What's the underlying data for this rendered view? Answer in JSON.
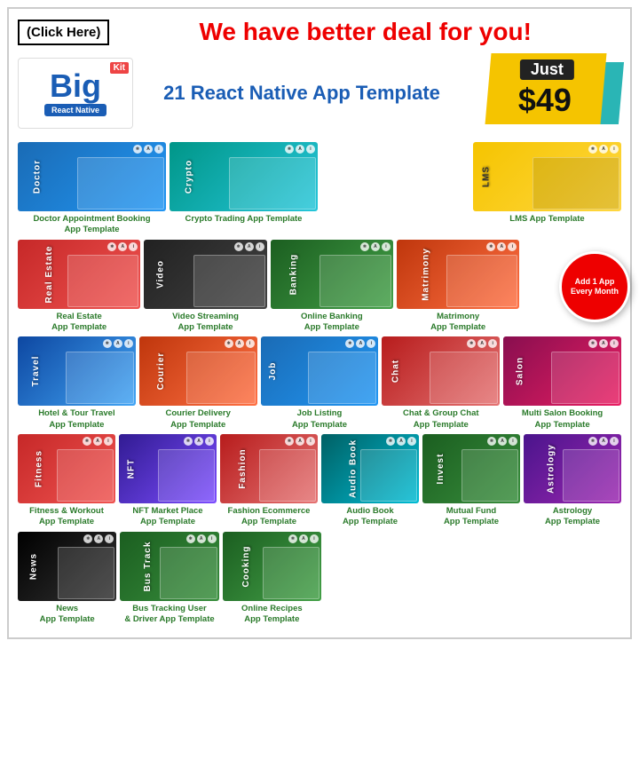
{
  "header": {
    "click_here": "(Click Here)",
    "deal_text": "We have better deal for you!"
  },
  "promo": {
    "logo_big": "Big",
    "logo_kit": "Kit",
    "logo_rn": "React Native",
    "template_count": "21 React Native App Template",
    "price_just": "Just",
    "price_amount": "$49"
  },
  "add_badge": "Add 1 App Every Month",
  "apps": [
    {
      "id": "doctor",
      "label": "Doctor",
      "title1": "Doctor Appointment Booking",
      "title2": "App Template",
      "bg": "bg-blue"
    },
    {
      "id": "crypto",
      "label": "Crypto",
      "title1": "Crypto Trading App Template",
      "title2": "",
      "bg": "bg-teal"
    },
    {
      "id": "lms",
      "label": "LMS",
      "title1": "LMS App Template",
      "title2": "",
      "bg": "bg-yellow"
    },
    {
      "id": "real-estate",
      "label": "Real Estate",
      "title1": "Real Estate",
      "title2": "App Template",
      "bg": "bg-red"
    },
    {
      "id": "video",
      "label": "Video",
      "title1": "Video Streaming",
      "title2": "App Template",
      "bg": "bg-dark"
    },
    {
      "id": "banking",
      "label": "Banking",
      "title1": "Online Banking",
      "title2": "App Template",
      "bg": "bg-green"
    },
    {
      "id": "matrimony",
      "label": "Matrimony",
      "title1": "Matrimony",
      "title2": "App Template",
      "bg": "bg-orange"
    },
    {
      "id": "travel",
      "label": "Travel",
      "title1": "Hotel & Tour Travel",
      "title2": "App Template",
      "bg": "bg-navy"
    },
    {
      "id": "courier",
      "label": "Courier",
      "title1": "Courier Delivery",
      "title2": "App Template",
      "bg": "bg-orange"
    },
    {
      "id": "job",
      "label": "Job",
      "title1": "Job Listing",
      "title2": "App Template",
      "bg": "bg-blue"
    },
    {
      "id": "chat",
      "label": "Chat",
      "title1": "Chat & Group Chat",
      "title2": "App Template",
      "bg": "bg-crimson"
    },
    {
      "id": "salon",
      "label": "Salon",
      "title1": "Multi Salon Booking",
      "title2": "App Template",
      "bg": "bg-pink"
    },
    {
      "id": "fitness",
      "label": "Fitness",
      "title1": "Fitness & Workout",
      "title2": "App Template",
      "bg": "bg-red"
    },
    {
      "id": "nft",
      "label": "NFT",
      "title1": "NFT Market Place",
      "title2": "App Template",
      "bg": "bg-indigo"
    },
    {
      "id": "fashion",
      "label": "Fashion",
      "title1": "Fashion Ecommerce",
      "title2": "App Template",
      "bg": "bg-crimson"
    },
    {
      "id": "audiobook",
      "label": "Audio Book",
      "title1": "Audio Book",
      "title2": "App Template",
      "bg": "bg-cyan"
    },
    {
      "id": "invest",
      "label": "Invest",
      "title1": "Mutual Fund",
      "title2": "App Template",
      "bg": "bg-darkgreen"
    },
    {
      "id": "astrology",
      "label": "Astrology",
      "title1": "Astrology",
      "title2": "App Template",
      "bg": "bg-purple"
    },
    {
      "id": "news",
      "label": "News",
      "title1": "News",
      "title2": "App Template",
      "bg": "bg-black"
    },
    {
      "id": "bustrack",
      "label": "Bus Track",
      "title1": "Bus Tracking User",
      "title2": "& Driver App Template",
      "bg": "bg-darkgreen"
    },
    {
      "id": "cooking",
      "label": "Cooking",
      "title1": "Online Recipes",
      "title2": "App Template",
      "bg": "bg-green"
    }
  ]
}
